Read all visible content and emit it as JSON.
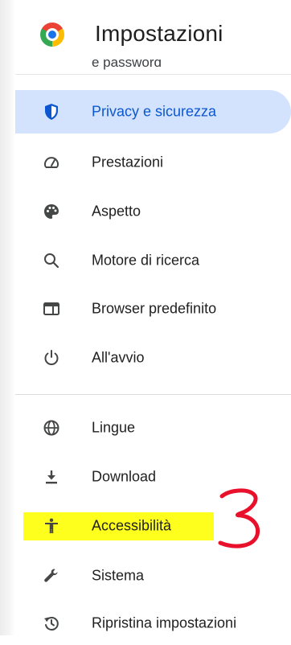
{
  "header": {
    "title": "Impostazioni",
    "partial_item": "e password"
  },
  "menu": {
    "active_item": "Privacy e sicurezza",
    "items": [
      {
        "label": "Privacy e sicurezza",
        "icon": "shield-icon"
      },
      {
        "label": "Prestazioni",
        "icon": "speedometer-icon"
      },
      {
        "label": "Aspetto",
        "icon": "palette-icon"
      },
      {
        "label": "Motore di ricerca",
        "icon": "search-icon"
      },
      {
        "label": "Browser predefinito",
        "icon": "browser-window-icon"
      },
      {
        "label": "All'avvio",
        "icon": "power-icon"
      },
      {
        "label": "Lingue",
        "icon": "globe-icon"
      },
      {
        "label": "Download",
        "icon": "download-icon"
      },
      {
        "label": "Accessibilità",
        "icon": "accessibility-icon"
      },
      {
        "label": "Sistema",
        "icon": "wrench-icon"
      },
      {
        "label": "Ripristina impostazioni",
        "icon": "restore-icon"
      }
    ]
  },
  "annotation": {
    "text": "3",
    "color": "#e8102a",
    "highlight_color": "#ffff1e"
  },
  "colors": {
    "active_bg": "#d3e3fd",
    "active_text": "#0b57d0",
    "icon": "#444746"
  }
}
